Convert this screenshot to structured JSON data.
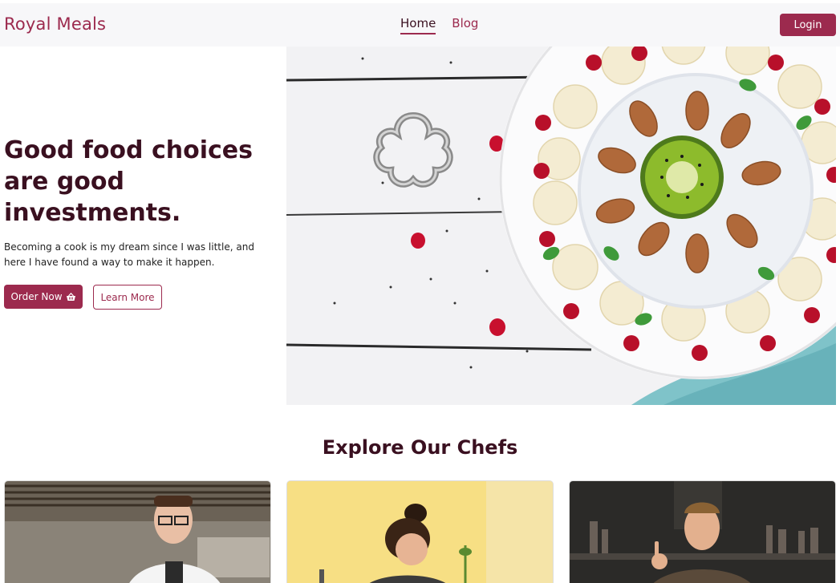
{
  "navbar": {
    "brand": "Royal Meals",
    "links": [
      {
        "label": "Home",
        "active": true
      },
      {
        "label": "Blog",
        "active": false
      }
    ],
    "login_label": "Login"
  },
  "hero": {
    "title": "Good food choices are good investments.",
    "description": "Becoming a cook is my dream since I was little, and here I have found a way to make it happen.",
    "order_label": "Order Now",
    "order_icon": "shopping-basket-icon",
    "learn_label": "Learn More",
    "image": "chia-pudding-bowl-photo"
  },
  "chefs": {
    "title": "Explore Our Chefs",
    "cards": [
      {
        "image": "chef-glasses-kitchen-photo"
      },
      {
        "image": "chef-woman-yellow-kitchen-photo"
      },
      {
        "image": "chef-ok-gesture-photo"
      }
    ]
  },
  "colors": {
    "accent": "#9c2a4e",
    "heading": "#3a1020",
    "navbar_bg": "#f7f7f9"
  }
}
